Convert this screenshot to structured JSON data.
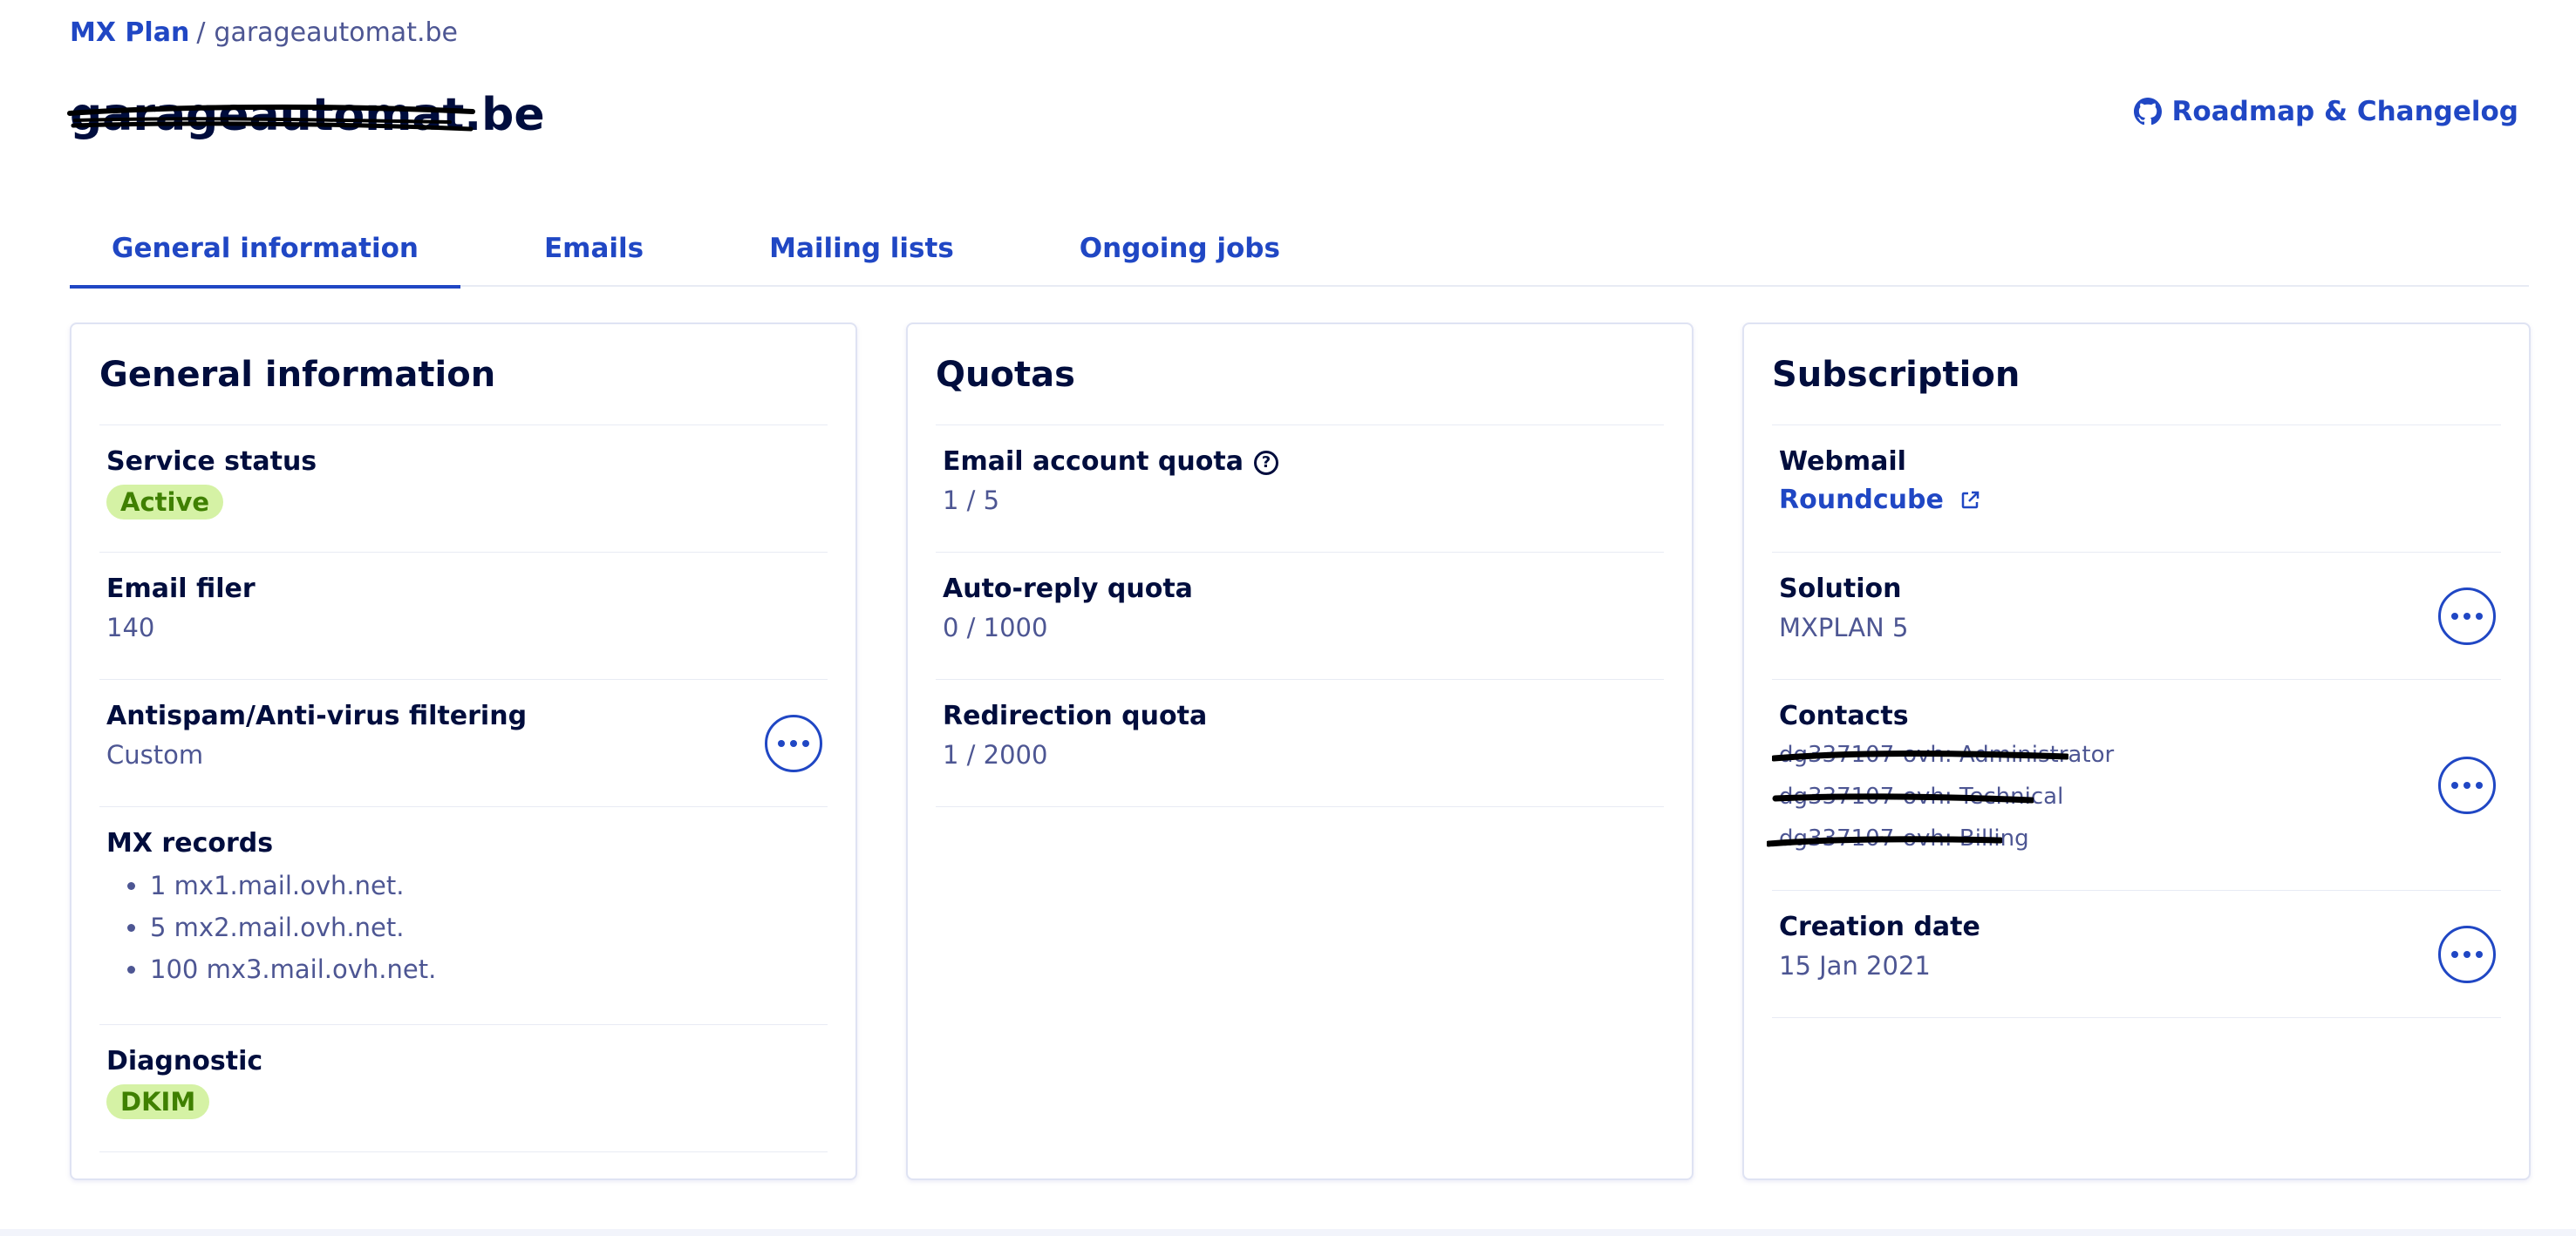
{
  "breadcrumb": {
    "root": "MX Plan",
    "separator": "/",
    "current": "garageautomat.be"
  },
  "page": {
    "title": "garageautomat.be"
  },
  "roadmap": {
    "label": "Roadmap & Changelog",
    "icon": "github-icon"
  },
  "tabs": [
    {
      "label": "General information",
      "active": true
    },
    {
      "label": "Emails",
      "active": false
    },
    {
      "label": "Mailing lists",
      "active": false
    },
    {
      "label": "Ongoing jobs",
      "active": false
    }
  ],
  "general": {
    "title": "General information",
    "service_status": {
      "label": "Service status",
      "badge": "Active"
    },
    "email_filer": {
      "label": "Email filer",
      "value": "140"
    },
    "antispam": {
      "label": "Antispam/Anti-virus filtering",
      "value": "Custom"
    },
    "mx_records": {
      "label": "MX records",
      "items": [
        "1 mx1.mail.ovh.net.",
        "5 mx2.mail.ovh.net.",
        "100 mx3.mail.ovh.net."
      ]
    },
    "diagnostic": {
      "label": "Diagnostic",
      "badge": "DKIM"
    }
  },
  "quotas": {
    "title": "Quotas",
    "email_account": {
      "label": "Email account quota",
      "value": "1 / 5",
      "help": "?"
    },
    "auto_reply": {
      "label": "Auto-reply quota",
      "value": "0 / 1000"
    },
    "redirection": {
      "label": "Redirection quota",
      "value": "1 / 2000"
    }
  },
  "subscription": {
    "title": "Subscription",
    "webmail": {
      "label": "Webmail",
      "link": "Roundcube"
    },
    "solution": {
      "label": "Solution",
      "value": "MXPLAN 5"
    },
    "contacts": {
      "label": "Contacts",
      "lines": [
        "dg337107-ovh: Administrator",
        "dg337107-ovh: Technical",
        "dg337107-ovh: Billing"
      ]
    },
    "creation": {
      "label": "Creation date",
      "value": "15 Jan 2021"
    }
  },
  "colors": {
    "primary": "#2047c4",
    "heading": "#000d3d",
    "muted": "#4d5693",
    "badge_bg": "#d5f2a5",
    "badge_text": "#3f8001"
  }
}
